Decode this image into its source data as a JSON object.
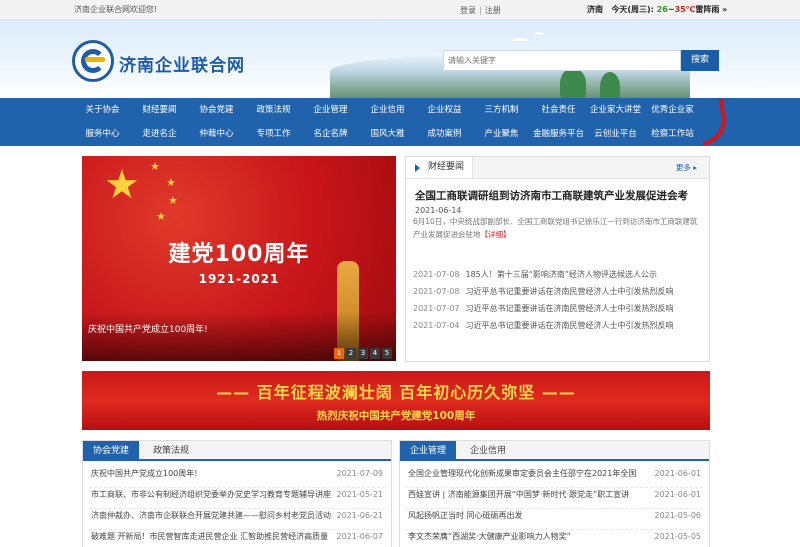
{
  "topbar": {
    "welcome": "济南企业联合网欢迎您!",
    "login": "登录",
    "separator": "|",
    "register": "注册",
    "city": "济南",
    "day": "今天(周三):",
    "temp_low": "26",
    "temp_sep": "~",
    "temp_high": "35℃",
    "condition": "雷阵雨",
    "arrow": "»"
  },
  "header": {
    "site_name": "济南企业联合网",
    "search_placeholder": "请输入关键字",
    "search_button": "搜索"
  },
  "nav": {
    "row1": [
      "关于协会",
      "财经要闻",
      "协会党建",
      "政策法规",
      "企业管理",
      "企业信用",
      "企业权益",
      "三方机制",
      "社会责任",
      "企业家大讲堂",
      "优秀企业家"
    ],
    "row2": [
      "服务中心",
      "走进名企",
      "仲裁中心",
      "专项工作",
      "名企名牌",
      "国风大雅",
      "成功案例",
      "产业聚焦",
      "金融服务平台",
      "云创业平台",
      "检察工作站"
    ]
  },
  "slider": {
    "title": "建党100周年",
    "years": "1921-2021",
    "caption": "庆祝中国共产党成立100周年!",
    "pages": [
      "1",
      "2",
      "3",
      "4",
      "5"
    ],
    "active_page": "1"
  },
  "news": {
    "tab": "财经要闻",
    "more": "更多 ▸",
    "headline": "全国工商联调研组到访济南市工商联建筑产业发展促进会考",
    "headline_date": "2021-06-14",
    "summary": "6月10日，中央统战部副部长、全国工商联党组书记徐乐江一行到访济南市工商联建筑产业发展促进会驻地",
    "detail_link": "【详细】",
    "items": [
      {
        "date": "2021-07-08",
        "title": "185人！第十三届“影响济南”经济人物评选候选人公示"
      },
      {
        "date": "2021-07-08",
        "title": "习近平总书记重要讲话在济南民营经济人士中引发热烈反响"
      },
      {
        "date": "2021-07-07",
        "title": "习近平总书记重要讲话在济南民营经济人士中引发热烈反响"
      },
      {
        "date": "2021-07-04",
        "title": "习近平总书记重要讲话在济南民营经济人士中引发热烈反响"
      }
    ]
  },
  "long_banner": {
    "line1": "—— 百年征程波澜壮阔  百年初心历久弥坚 ——",
    "line2": "热烈庆祝中国共产党建党100周年"
  },
  "left_panel": {
    "tab_active": "协会党建",
    "tab_other": "政策法规",
    "items": [
      {
        "title": "庆祝中国共产党成立100周年!",
        "date": "2021-07-09"
      },
      {
        "title": "市工商联、市非公有制经济组织党委举办党史学习教育专题辅导讲座",
        "date": "2021-05-21"
      },
      {
        "title": "济南仲裁办、济南市企联联合开展党建共建——慰问乡村老党员活动",
        "date": "2021-06-21"
      },
      {
        "title": "破难题 开新局！市民营智库走进民营企业 汇智助推民营经济高质量",
        "date": "2021-06-07"
      }
    ]
  },
  "right_panel": {
    "tab_active": "企业管理",
    "tab_other": "企业信用",
    "items": [
      {
        "title": "全国企业管理现代化创新成果审定委员会主任邵宁在2021年全国",
        "date": "2021-06-01"
      },
      {
        "title": "西娃宣讲 | 济南能源集团开展“中国梦·新时代·跟党走”职工宣讲",
        "date": "2021-06-01"
      },
      {
        "title": "风起扬帆正当时 同心砥砺再出发",
        "date": "2021-05-06"
      },
      {
        "title": "李文杰荣膺“西湖奖·大健康产业影响力人物奖”",
        "date": "2021-05-05"
      }
    ]
  },
  "colors": {
    "brand_blue": "#2062ac",
    "party_red": "#c6141a",
    "accent_orange": "#e8680e",
    "banner_gold": "#ffd84a"
  }
}
